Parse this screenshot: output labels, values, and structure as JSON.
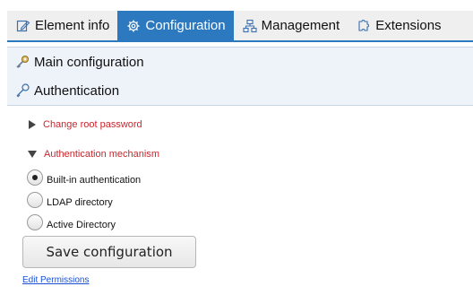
{
  "tabs": [
    {
      "label": "Element info",
      "icon": "edit-document-icon",
      "active": false
    },
    {
      "label": "Configuration",
      "icon": "gear-icon",
      "active": true
    },
    {
      "label": "Management",
      "icon": "sitemap-icon",
      "active": false
    },
    {
      "label": "Extensions",
      "icon": "puzzle-icon",
      "active": false
    }
  ],
  "panels": {
    "main": {
      "label": "Main configuration",
      "icon": "key-ring-icon"
    },
    "auth": {
      "label": "Authentication",
      "icon": "key-icon"
    }
  },
  "sections": {
    "change_root": "Change root password",
    "auth_mechanism": "Authentication mechanism"
  },
  "options": [
    {
      "label": "Built-in authentication",
      "selected": true
    },
    {
      "label": "LDAP directory",
      "selected": false
    },
    {
      "label": "Active Directory",
      "selected": false
    }
  ],
  "save_label": "Save configuration",
  "edit_permissions": "Edit Permissions",
  "colors": {
    "accent": "#2d79bf",
    "section_link": "#c9252d",
    "link": "#1a4fd6"
  }
}
